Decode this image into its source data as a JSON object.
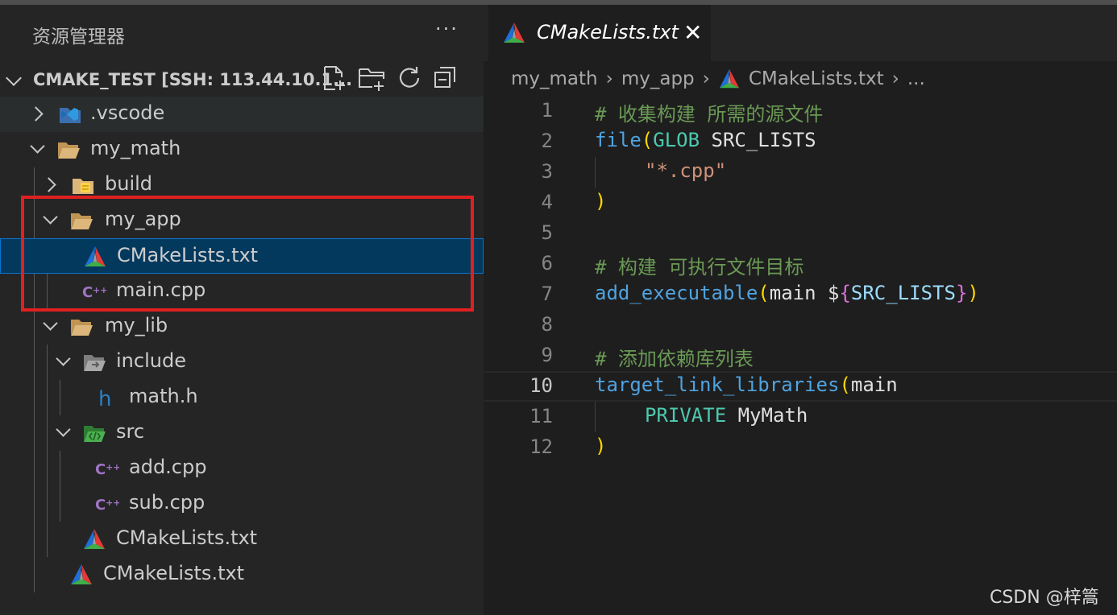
{
  "sidebar": {
    "title": "资源管理器",
    "more": "···",
    "section": "CMAKE_TEST [SSH: 113.44.10.1...",
    "items": [
      {
        "label": ".vscode"
      },
      {
        "label": "my_math"
      },
      {
        "label": "build"
      },
      {
        "label": "my_app"
      },
      {
        "label": "CMakeLists.txt"
      },
      {
        "label": "main.cpp"
      },
      {
        "label": "my_lib"
      },
      {
        "label": "include"
      },
      {
        "label": "math.h"
      },
      {
        "label": "src"
      },
      {
        "label": "add.cpp"
      },
      {
        "label": "sub.cpp"
      },
      {
        "label": "CMakeLists.txt"
      },
      {
        "label": "CMakeLists.txt"
      }
    ]
  },
  "editor": {
    "tab": {
      "label": "CMakeLists.txt",
      "close": "✕"
    },
    "breadcrumbs": [
      "my_math",
      "my_app",
      "CMakeLists.txt",
      "..."
    ],
    "line_numbers": [
      "1",
      "2",
      "3",
      "4",
      "5",
      "6",
      "7",
      "8",
      "9",
      "10",
      "11",
      "12"
    ],
    "code": {
      "l1": "# 收集构建 所需的源文件",
      "l2_fn": "file",
      "l2_open": "(",
      "l2_kw": "GLOB",
      "l2_rest": " SRC_LISTS",
      "l3": "\"*.cpp\"",
      "l4": ")",
      "l6": "# 构建 可执行文件目标",
      "l7_fn": "add_executable",
      "l7_open": "(",
      "l7_arg": "main ",
      "l7_dollar": "$",
      "l7_lb": "{",
      "l7_var": "SRC_LISTS",
      "l7_rb": "}",
      "l7_close": ")",
      "l9": "# 添加依赖库列表",
      "l10_fn": "target_link_libraries",
      "l10_open": "(",
      "l10_arg": "main",
      "l11_kw": "PRIVATE",
      "l11_rest": " MyMath",
      "l12": ")"
    }
  },
  "watermark": "CSDN @梓篙",
  "colors": {
    "selection": "#04395e",
    "highlight_box": "#e02020",
    "accent": "#0a74cc"
  }
}
